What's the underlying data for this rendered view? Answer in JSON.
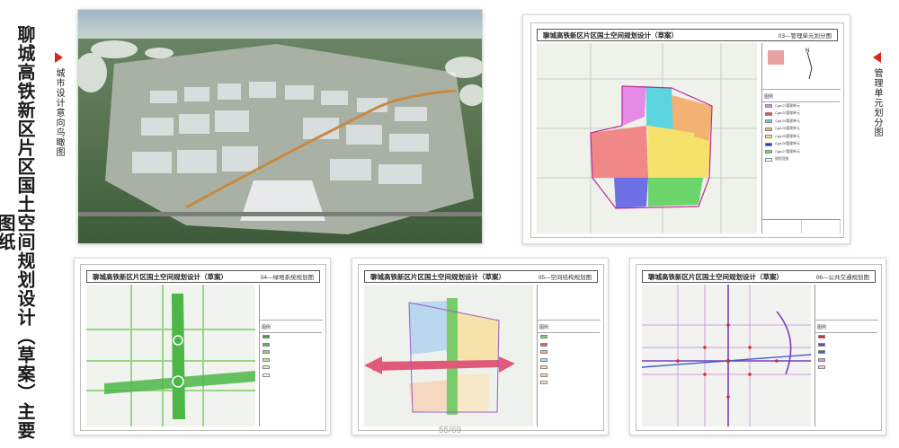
{
  "title": "聊城高铁新区片区国土空间规划设计（草案）主要图纸",
  "tags": {
    "aerial": "城市设计意向鸟瞰图",
    "management": "管理单元划分图"
  },
  "colors": {
    "accent_red": "#d9261c"
  },
  "sheets": {
    "s1": {
      "title": "聊城高铁新区片区国土空间规划设计（草案）",
      "num": "03—管理单元划分图",
      "legend_title": "图例",
      "legend": [
        "Cgd-01管理单元",
        "Cgd-02管理单元",
        "Cgd-03管理单元",
        "Cgd-04管理单元",
        "Cgd-05管理单元",
        "Cgd-06管理单元",
        "Cgd-07管理单元",
        "规划范围"
      ]
    },
    "s2": {
      "title": "聊城高铁新区片区国土空间规划设计（草案）",
      "num": "04—绿地系统规划图",
      "legend_title": "图例"
    },
    "s3": {
      "title": "聊城高铁新区片区国土空间规划设计（草案）",
      "num": "05—空间结构规划图",
      "legend_title": "图例"
    },
    "s4": {
      "title": "聊城高铁新区片区国土空间规划设计（草案）",
      "num": "06—公共交通规划图",
      "legend_title": "图例"
    }
  },
  "page_number": "55/69"
}
